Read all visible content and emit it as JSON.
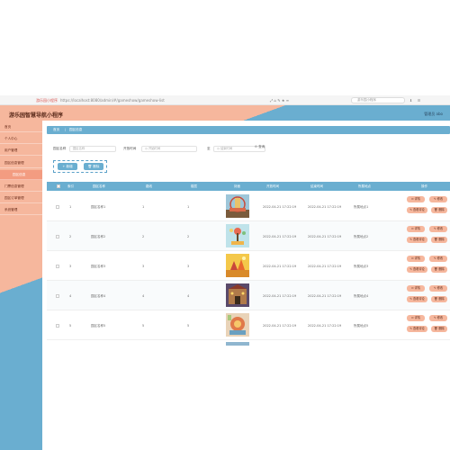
{
  "browser": {
    "tab_title": "游乐园小程序",
    "url": "https://localhost:8080/admin/#/gameshow/gameshow-list",
    "search_placeholder": "游乐园小程序",
    "toolbar_glyphs": "⤢ ⌂ ✎ ★ ≡"
  },
  "app": {
    "title": "游乐园智慧导航小程序",
    "admin_label": "管理员 abo"
  },
  "sidebar": {
    "items": [
      {
        "label": "首页"
      },
      {
        "label": "个人中心"
      },
      {
        "label": "用户管理"
      },
      {
        "label": "园区信息管理"
      },
      {
        "label": "园区信息"
      },
      {
        "label": "门票信息管理"
      },
      {
        "label": "园区订单管理"
      },
      {
        "label": "系统管理"
      }
    ],
    "active_index": 4
  },
  "breadcrumb": {
    "home": "首页",
    "current": "园区信息"
  },
  "filters": {
    "name_label": "园区名称",
    "name_placeholder": "园区名称",
    "start_label": "开放时间",
    "start_placeholder": "开始时间",
    "to_label": "至",
    "end_placeholder": "结束时间",
    "search_label": "查询"
  },
  "actions": {
    "add": "新增",
    "delete": "删除"
  },
  "table": {
    "headers": [
      "索引",
      "园区名称",
      "路线",
      "楼层",
      "封面",
      "开放时间",
      "结束时间",
      "所属地点",
      "操作"
    ],
    "rows": [
      {
        "index": "1",
        "name": "园区名称1",
        "route": "1",
        "floor": "1",
        "open": "2022-04-21 17:22:19",
        "close": "2022-04-21 17:22:19",
        "location": "所属地点1"
      },
      {
        "index": "2",
        "name": "园区名称2",
        "route": "2",
        "floor": "2",
        "open": "2022-04-21 17:22:19",
        "close": "2022-04-21 17:22:19",
        "location": "所属地点2"
      },
      {
        "index": "3",
        "name": "园区名称3",
        "route": "3",
        "floor": "3",
        "open": "2022-04-21 17:22:19",
        "close": "2022-04-21 17:22:19",
        "location": "所属地点3"
      },
      {
        "index": "4",
        "name": "园区名称4",
        "route": "4",
        "floor": "4",
        "open": "2022-04-21 17:22:19",
        "close": "2022-04-21 17:22:19",
        "location": "所属地点4"
      },
      {
        "index": "5",
        "name": "园区名称5",
        "route": "5",
        "floor": "5",
        "open": "2022-04-21 17:22:19",
        "close": "2022-04-21 17:22:19",
        "location": "所属地点5"
      }
    ],
    "row_actions": {
      "detail": "详情",
      "edit": "修改",
      "comment": "查看评论",
      "delete": "删除"
    }
  },
  "colors": {
    "peach": "#f6b79d",
    "blue": "#6aaed0",
    "accent": "#f39c81"
  }
}
